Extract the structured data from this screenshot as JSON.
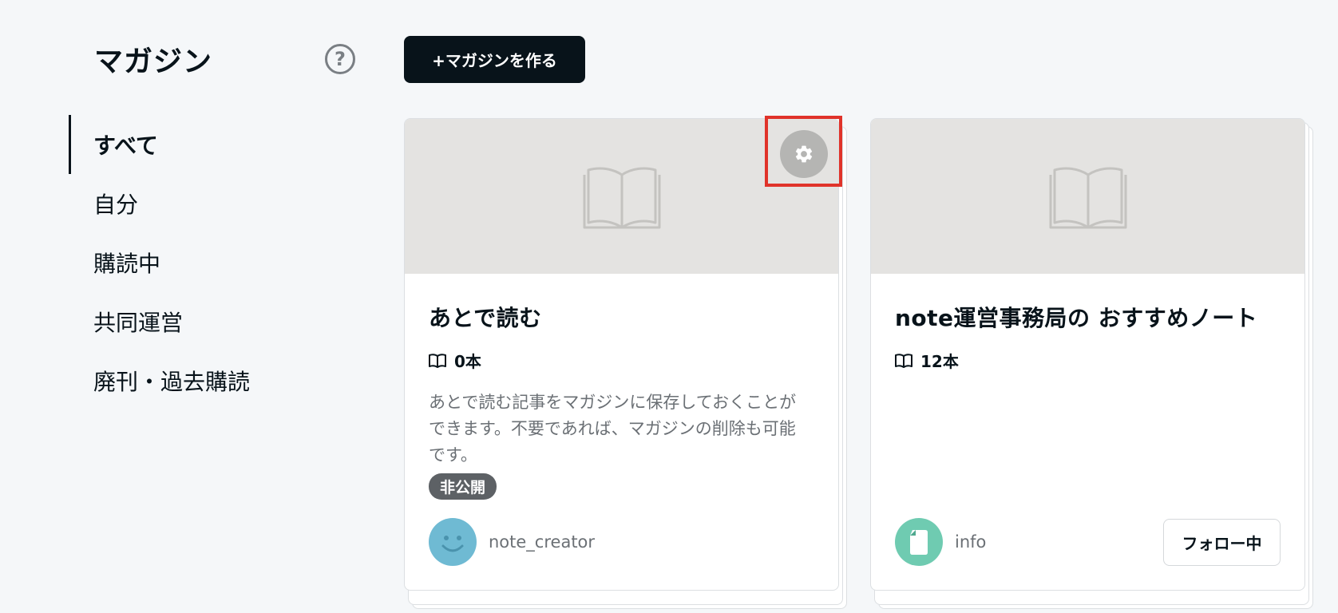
{
  "header": {
    "title": "マガジン",
    "help_icon": "question-circle-icon",
    "create_button": "+マガジンを作る"
  },
  "sidebar": {
    "items": [
      {
        "label": "すべて",
        "active": true
      },
      {
        "label": "自分",
        "active": false
      },
      {
        "label": "購読中",
        "active": false
      },
      {
        "label": "共同運営",
        "active": false
      },
      {
        "label": "廃刊・過去購読",
        "active": false
      }
    ]
  },
  "cards": [
    {
      "title": "あとで読む",
      "count": "0本",
      "description": "あとで読む記事をマガジンに保存しておくことができます。不要であれば、マガジンの削除も可能です。",
      "badge": "非公開",
      "creator": "note_creator",
      "avatar_icon": "smiley-avatar-icon",
      "settings_icon": "gear-icon"
    },
    {
      "title": "note運営事務局の おすすめノート",
      "count": "12本",
      "creator": "info",
      "avatar_icon": "document-avatar-icon",
      "follow_button": "フォロー中"
    }
  ],
  "colors": {
    "background": "#f5f7f9",
    "primary": "#08131a",
    "highlight": "#e0332a",
    "badge": "#5d6165"
  }
}
